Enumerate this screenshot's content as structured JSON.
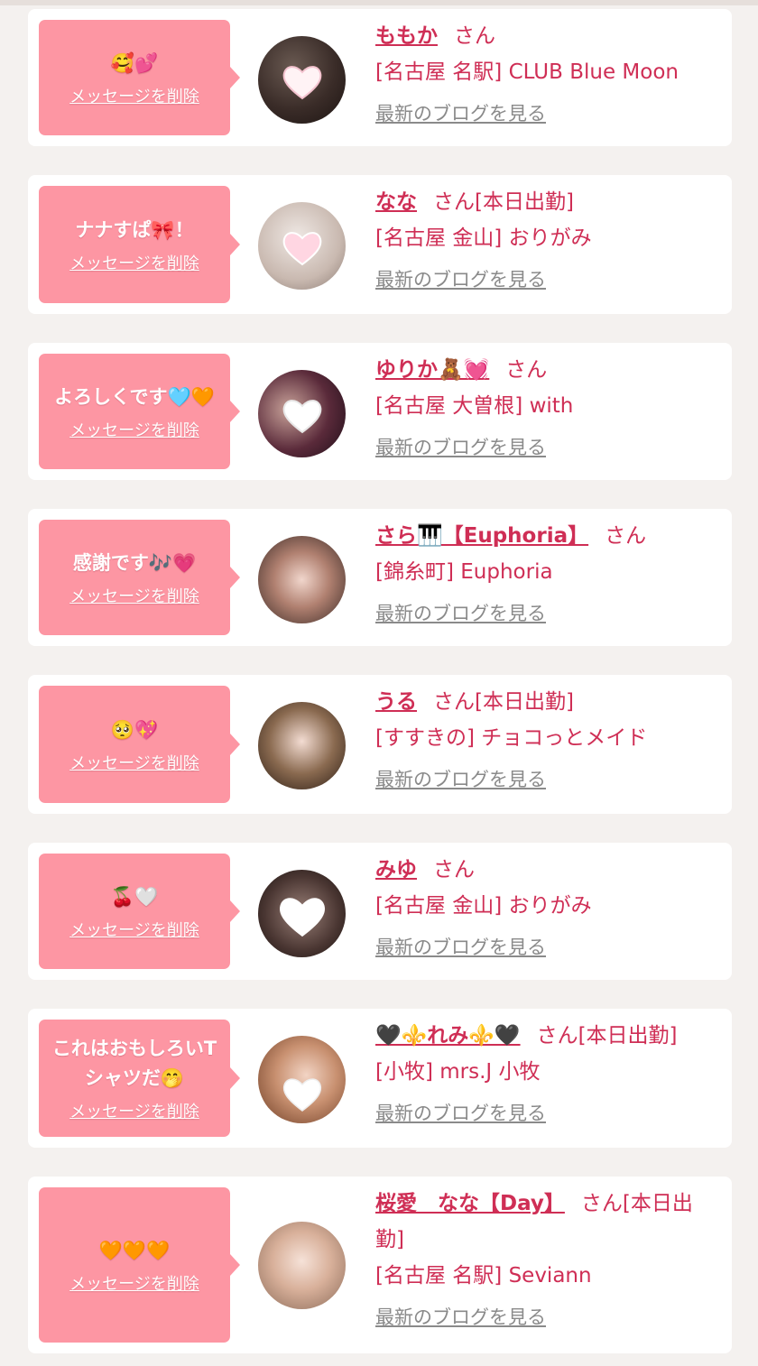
{
  "common": {
    "delete_label": "メッセージを削除",
    "blog_label": "最新のブログを見る",
    "san": "さん"
  },
  "colors": {
    "bubble": "#fd96a3",
    "name": "#cf2e55",
    "link_gray": "#8a8a8a"
  },
  "items": [
    {
      "message": "🥰💕",
      "name": "ももか",
      "status": "",
      "shop": "[名古屋 名駅] CLUB Blue Moon",
      "avatar_icon": "avatar-photo"
    },
    {
      "message": "ナナすぱ🎀！",
      "name": "なな",
      "status": "[本日出勤]",
      "shop": "[名古屋 金山] おりがみ",
      "avatar_icon": "avatar-photo"
    },
    {
      "message": "よろしくです🩵🧡",
      "name": "ゆりか🧸💓",
      "status": "",
      "shop": "[名古屋 大曽根] with",
      "avatar_icon": "avatar-photo"
    },
    {
      "message": "感謝です🎶💗",
      "name": "さら🎹【Euphoria】",
      "status": "",
      "shop": "[錦糸町] Euphoria",
      "avatar_icon": "avatar-photo"
    },
    {
      "message": "🥺💖",
      "name": "うる",
      "status": "[本日出勤]",
      "shop": "[すすきの] チョコっとメイド",
      "avatar_icon": "avatar-photo"
    },
    {
      "message": "🍒🤍",
      "name": "みゆ",
      "status": "",
      "shop": "[名古屋 金山] おりがみ",
      "avatar_icon": "avatar-photo"
    },
    {
      "message": "これはおもしろいTシャツだ🤭",
      "name": "🖤⚜️れみ⚜️🖤",
      "status": "[本日出勤]",
      "shop": "[小牧] mrs.J 小牧",
      "avatar_icon": "avatar-photo"
    },
    {
      "message": "🧡🧡🧡",
      "name": "桜愛　なな【Day】",
      "status": "[本日出勤]",
      "shop": "[名古屋 名駅] Seviann",
      "avatar_icon": "avatar-photo"
    }
  ]
}
